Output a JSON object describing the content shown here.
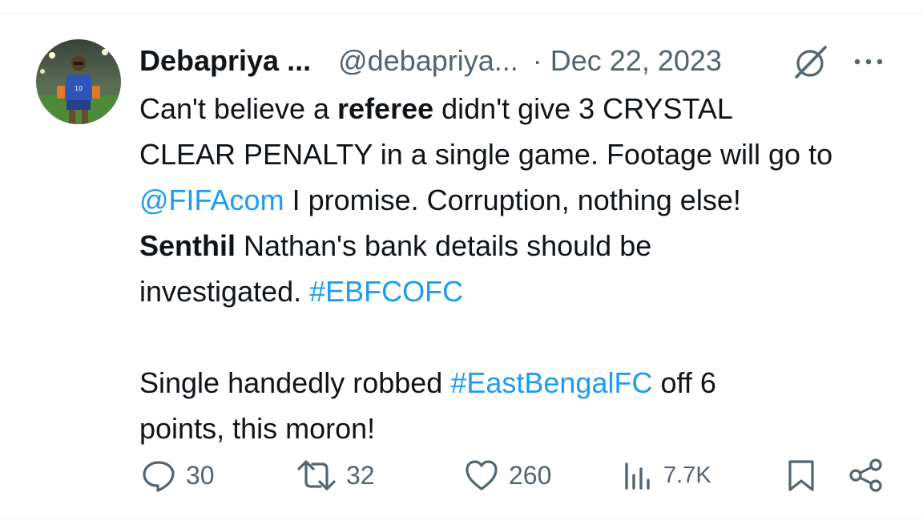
{
  "tweet": {
    "author_name": "Debapriya ...",
    "handle": "@debapriya...",
    "separator": "·",
    "date": "Dec 22, 2023",
    "body": {
      "l1_a": "Can't believe a ",
      "l1_bold": "referee",
      "l1_b": " didn't give 3 CRYSTAL",
      "l2": "CLEAR PENALTY in a single game. Footage will go to",
      "l3_mention": "@FIFAcom",
      "l3_rest": " I promise. Corruption, nothing else!",
      "l4_bold": "Senthil",
      "l4_rest": " Nathan's bank details should be",
      "l5_a": "investigated. ",
      "l5_hashtag": "#EBFCOFC",
      "l6_a": "Single handedly robbed ",
      "l6_hashtag": "#EastBengalFC",
      "l6_b": " off 6",
      "l7": "points, this moron!"
    },
    "actions": {
      "replies": "30",
      "reposts": "32",
      "likes": "260",
      "views": "7.7K"
    }
  },
  "icons": {
    "avatar": "avatar-photo",
    "grok": "grok-icon",
    "more": "more-icon",
    "reply": "reply-icon",
    "repost": "retweet-icon",
    "like": "heart-icon",
    "views": "views-icon",
    "bookmark": "bookmark-icon",
    "share": "share-icon"
  },
  "colors": {
    "link": "#1d9bf0",
    "secondary_text": "#536471",
    "primary_text": "#0f1419"
  }
}
